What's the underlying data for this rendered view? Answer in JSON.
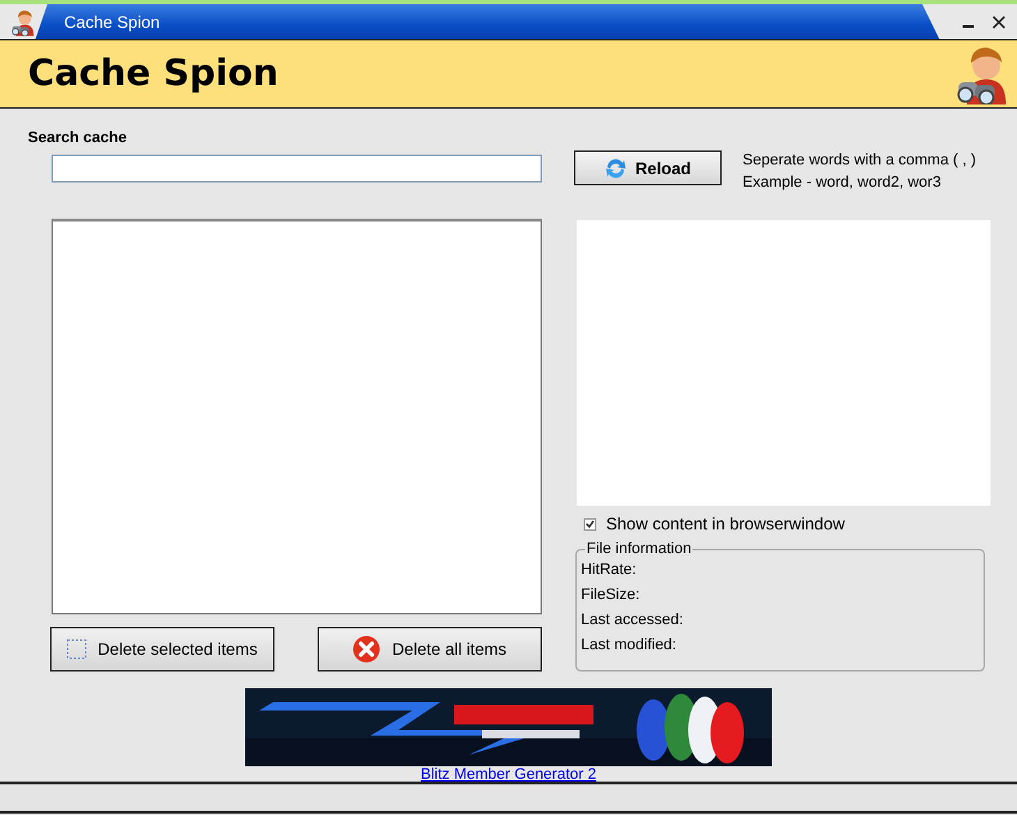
{
  "window": {
    "title": "Cache Spion"
  },
  "header": {
    "title": "Cache Spion"
  },
  "search": {
    "label": "Search cache"
  },
  "reload_button": "Reload",
  "hint": [
    "Seperate words with a comma ( , )",
    "Example - word, word2, wor3"
  ],
  "show_content": {
    "label": "Show content in browserwindow",
    "checked": true
  },
  "file_information": {
    "title": "File information",
    "fields": [
      "HitRate:",
      "FileSize:",
      "Last accessed:",
      "Last modified:"
    ]
  },
  "buttons": [
    {
      "label": "Delete selected items",
      "kind": "dotted"
    },
    {
      "label": "Delete all items",
      "kind": "delete"
    }
  ],
  "link": "Blitz Member Generator 2"
}
